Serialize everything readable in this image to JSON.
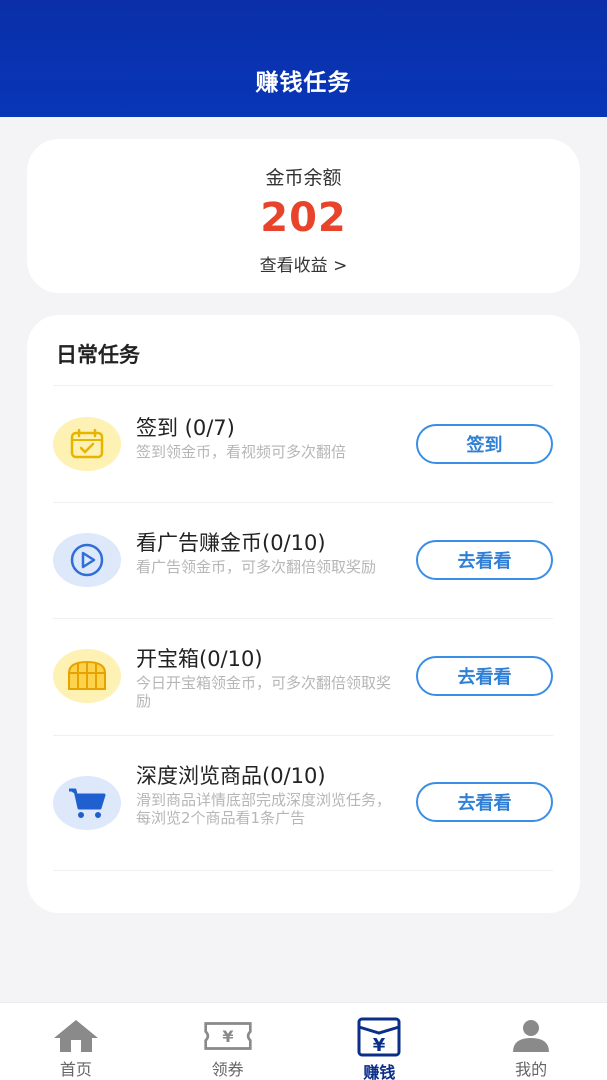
{
  "header": {
    "title": "赚钱任务"
  },
  "balance": {
    "label": "金币余额",
    "value": "202",
    "link": "查看收益 >"
  },
  "daily": {
    "title": "日常任务",
    "tasks": [
      {
        "name": "签到 (0/7)",
        "desc": "签到领金币，看视频可多次翻倍",
        "button": "签到",
        "icon": "calendar-check-icon"
      },
      {
        "name": "看广告赚金币(0/10)",
        "desc": "看广告领金币，可多次翻倍领取奖励",
        "button": "去看看",
        "icon": "play-icon"
      },
      {
        "name": "开宝箱(0/10)",
        "desc": "今日开宝箱领金币，可多次翻倍领取奖励",
        "button": "去看看",
        "icon": "treasure-chest-icon"
      },
      {
        "name": "深度浏览商品(0/10)",
        "desc": "滑到商品详情底部完成深度浏览任务，每浏览2个商品看1条广告",
        "button": "去看看",
        "icon": "cart-icon"
      }
    ]
  },
  "tabbar": {
    "items": [
      {
        "label": "首页",
        "icon": "home-icon"
      },
      {
        "label": "领券",
        "icon": "coupon-icon"
      },
      {
        "label": "赚钱",
        "icon": "earn-icon"
      },
      {
        "label": "我的",
        "icon": "user-icon"
      }
    ],
    "active_index": 2
  },
  "colors": {
    "header": "#0836b8",
    "balance": "#e8432b",
    "accent": "#3a8ee6",
    "active_tab": "#0a2f8a"
  }
}
